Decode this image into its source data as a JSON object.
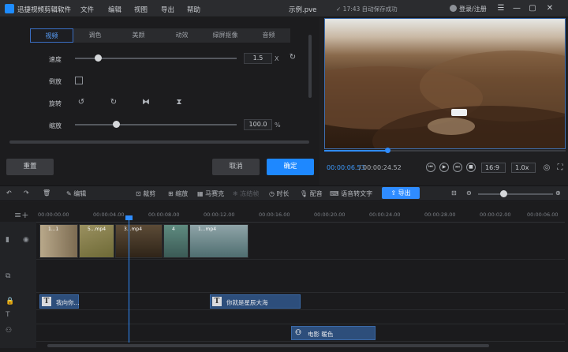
{
  "titlebar": {
    "app_name": "迅捷视频剪辑软件",
    "menus": [
      "文件",
      "编辑",
      "视图",
      "导出",
      "帮助"
    ],
    "file_title": "示例.pve",
    "autosave": "✓ 17:43 自动保存成功",
    "login": "登录/注册"
  },
  "tabs": [
    "视频",
    "调色",
    "美颜",
    "动效",
    "绿屏抠像",
    "音频"
  ],
  "properties": {
    "speed_label": "速度",
    "speed_value": "1.5",
    "speed_unit": "X",
    "reverse_label": "倒放",
    "rotate_label": "旋转",
    "scale_label": "缩放",
    "scale_value": "100.0",
    "scale_unit": "%"
  },
  "buttons": {
    "reset": "重置",
    "cancel": "取消",
    "confirm": "确定"
  },
  "player": {
    "current_time": "00:00:06.53",
    "separator": "/",
    "total_time": "00:00:24.52",
    "aspect": "16:9",
    "speed": "1.0x",
    "progress": 0.26
  },
  "toolbar": {
    "edit": "编辑",
    "crop": "裁剪",
    "zoom": "缩放",
    "mosaic": "马赛克",
    "freeze": "冻结帧",
    "duration": "时长",
    "dub": "配音",
    "speech_to_text": "语音转文字",
    "export": "导出"
  },
  "ruler_ticks": [
    "00:00:00.00",
    "00:00:04.00",
    "00:00:08.00",
    "00:00:12.00",
    "00:00:16.00",
    "00:00:20.00",
    "00:00:24.00",
    "00:00:28.00",
    "00:00:02.00",
    "00:00:06.00"
  ],
  "video_clips": [
    {
      "label": "1...1"
    },
    {
      "label": "5...mp4"
    },
    {
      "label": "3...mp4"
    },
    {
      "label": "4"
    },
    {
      "label": "1...mp4"
    }
  ],
  "text_clips": [
    {
      "label": "我向你..."
    },
    {
      "label": "你就是星辰大海"
    }
  ],
  "effect_clip": {
    "label": "电影 暖色"
  },
  "colors": {
    "accent": "#2f8cff",
    "confirm": "#1e88ff"
  }
}
